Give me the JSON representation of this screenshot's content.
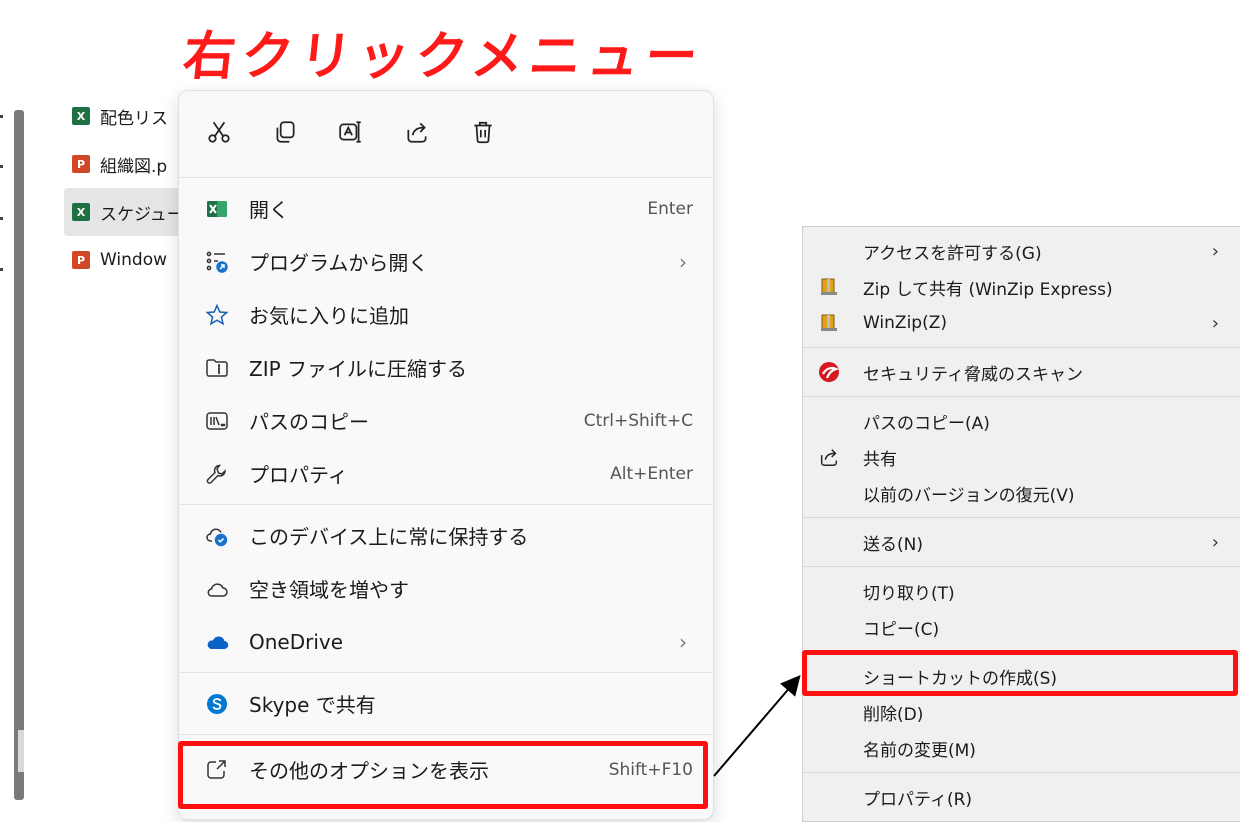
{
  "title": "右クリックメニュー",
  "explorer": {
    "files": [
      {
        "name": "配色リス",
        "type": "excel",
        "icon_label": "X"
      },
      {
        "name": "組織図.p",
        "type": "powerpoint",
        "icon_label": "P"
      },
      {
        "name": "スケジュー",
        "type": "excel",
        "icon_label": "X",
        "selected": true
      },
      {
        "name": "Window",
        "type": "powerpoint",
        "icon_label": "P"
      }
    ]
  },
  "context_menu": {
    "quick_actions": [
      "cut-icon",
      "copy-icon",
      "rename-icon",
      "share-icon",
      "delete-icon"
    ],
    "items": [
      {
        "label": "開く",
        "shortcut": "Enter",
        "icon": "excel-icon"
      },
      {
        "label": "プログラムから開く",
        "chevron": "›",
        "icon": "open-with-icon"
      },
      {
        "label": "お気に入りに追加",
        "icon": "star-icon"
      },
      {
        "label": "ZIP ファイルに圧縮する",
        "icon": "zip-folder-icon"
      },
      {
        "label": "パスのコピー",
        "shortcut": "Ctrl+Shift+C",
        "icon": "copy-path-icon"
      },
      {
        "label": "プロパティ",
        "shortcut": "Alt+Enter",
        "icon": "wrench-icon"
      },
      {
        "label": "このデバイス上に常に保持する",
        "icon": "cloud-keep-icon"
      },
      {
        "label": "空き領域を増やす",
        "icon": "cloud-outline-icon"
      },
      {
        "label": "OneDrive",
        "chevron": "›",
        "icon": "onedrive-icon"
      },
      {
        "label": "Skype で共有",
        "icon": "skype-icon"
      },
      {
        "label": "その他のオプションを表示",
        "shortcut": "Shift+F10",
        "icon": "more-options-icon"
      }
    ]
  },
  "classic_menu": {
    "items": [
      {
        "label": "アクセスを許可する(G)",
        "chevron": "›"
      },
      {
        "label": "Zip して共有 (WinZip Express)",
        "icon": "winzip-icon"
      },
      {
        "label": "WinZip(Z)",
        "chevron": "›",
        "icon": "winzip-icon"
      },
      {
        "label": "セキュリティ脅威のスキャン",
        "icon": "trend-micro-icon"
      },
      {
        "label": "パスのコピー(A)"
      },
      {
        "label": "共有",
        "icon": "share-icon"
      },
      {
        "label": "以前のバージョンの復元(V)"
      },
      {
        "label": "送る(N)",
        "chevron": "›"
      },
      {
        "label": "切り取り(T)"
      },
      {
        "label": "コピー(C)"
      },
      {
        "label": "ショートカットの作成(S)"
      },
      {
        "label": "削除(D)"
      },
      {
        "label": "名前の変更(M)"
      },
      {
        "label": "プロパティ(R)"
      }
    ]
  },
  "colors": {
    "highlight": "#ff1010",
    "title": "#ff1a1a",
    "excel": "#1e7145",
    "powerpoint": "#d24726",
    "onedrive": "#0a64c8",
    "skype": "#0078d4",
    "trend": "#d71920"
  }
}
